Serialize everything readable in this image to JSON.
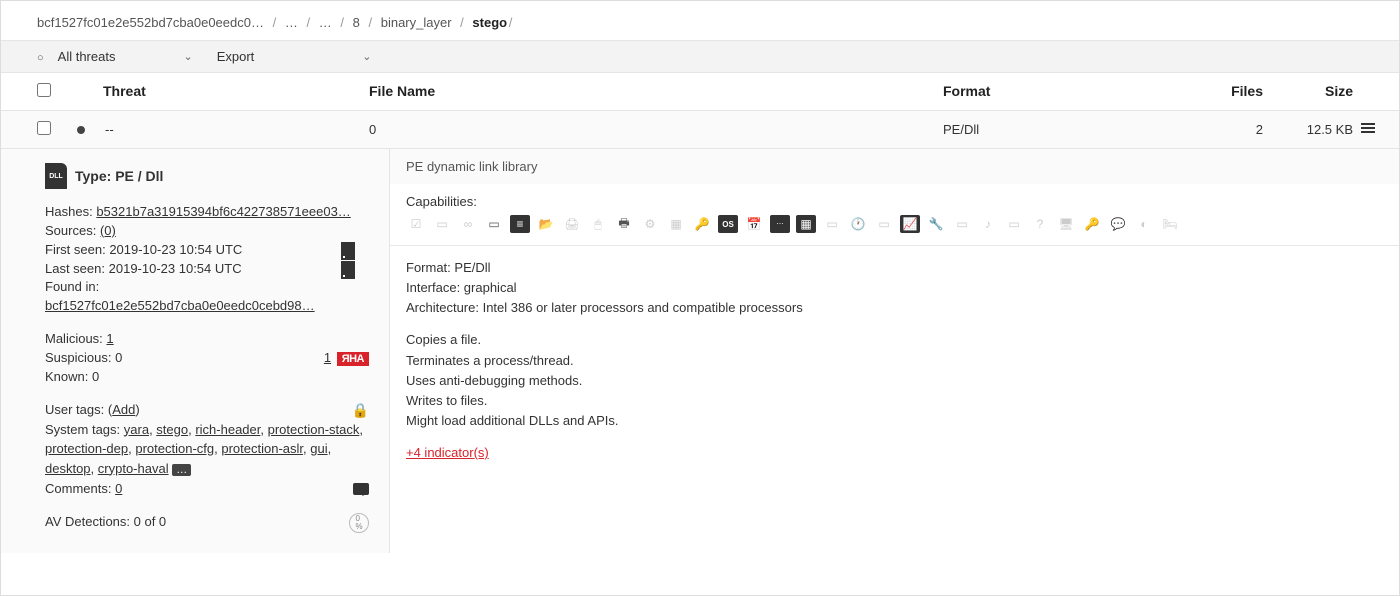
{
  "breadcrumb": {
    "hash": "bcf1527fc01e2e552bd7cba0e0eedc0…",
    "p1": "…",
    "p2": "…",
    "p3": "8",
    "p4": "binary_layer",
    "p5": "stego"
  },
  "toolbar": {
    "all_threats": "All threats",
    "export": "Export"
  },
  "columns": {
    "threat": "Threat",
    "filename": "File Name",
    "format": "Format",
    "files": "Files",
    "size": "Size"
  },
  "row": {
    "threat": "--",
    "filename": "0",
    "format": "PE/Dll",
    "files": "2",
    "size": "12.5 KB"
  },
  "left": {
    "type_label": "Type: PE / Dll",
    "dll_badge": "DLL",
    "hashes_label": "Hashes:",
    "hashes_value": "b5321b7a31915394bf6c422738571eee03…",
    "sources_label": "Sources:",
    "sources_value": "(0)",
    "first_seen_label": "First seen:",
    "first_seen_value": "2019-10-23 10:54 UTC",
    "last_seen_label": "Last seen:",
    "last_seen_value": "2019-10-23 10:54 UTC",
    "found_in_label": "Found in:",
    "found_in_value": "bcf1527fc01e2e552bd7cba0e0eedc0cebd98…",
    "malicious_label": "Malicious:",
    "malicious_value": "1",
    "suspicious_label": "Suspicious: 0",
    "known_label": "Known: 0",
    "yara_count": "1",
    "yara_badge": "ЯНА",
    "user_tags_label": "User tags:",
    "user_tags_add": "Add",
    "system_tags_label": "System tags:",
    "tag1": "yara",
    "tag2": "stego",
    "tag3": "rich-header",
    "tag4": "protection-stack",
    "tag5": "protection-dep",
    "tag6": "protection-cfg",
    "tag7": "protection-aslr",
    "tag8": "gui",
    "tag9": "desktop",
    "tag10": "crypto-haval",
    "tag_more": "…",
    "comments_label": "Comments:",
    "comments_value": "0",
    "av_label": "AV Detections: 0 of 0",
    "ring": "0\n%"
  },
  "right": {
    "header": "PE dynamic link library",
    "cap_label": "Capabilities:",
    "format_line": "Format: PE/Dll",
    "interface_line": "Interface: graphical",
    "arch_line": "Architecture: Intel 386 or later processors and compatible processors",
    "b1": "Copies a file.",
    "b2": "Terminates a process/thread.",
    "b3": "Uses anti-debugging methods.",
    "b4": "Writes to files.",
    "b5": "Might load additional DLLs and APIs.",
    "more_indicators": "+4 indicator(s)"
  }
}
